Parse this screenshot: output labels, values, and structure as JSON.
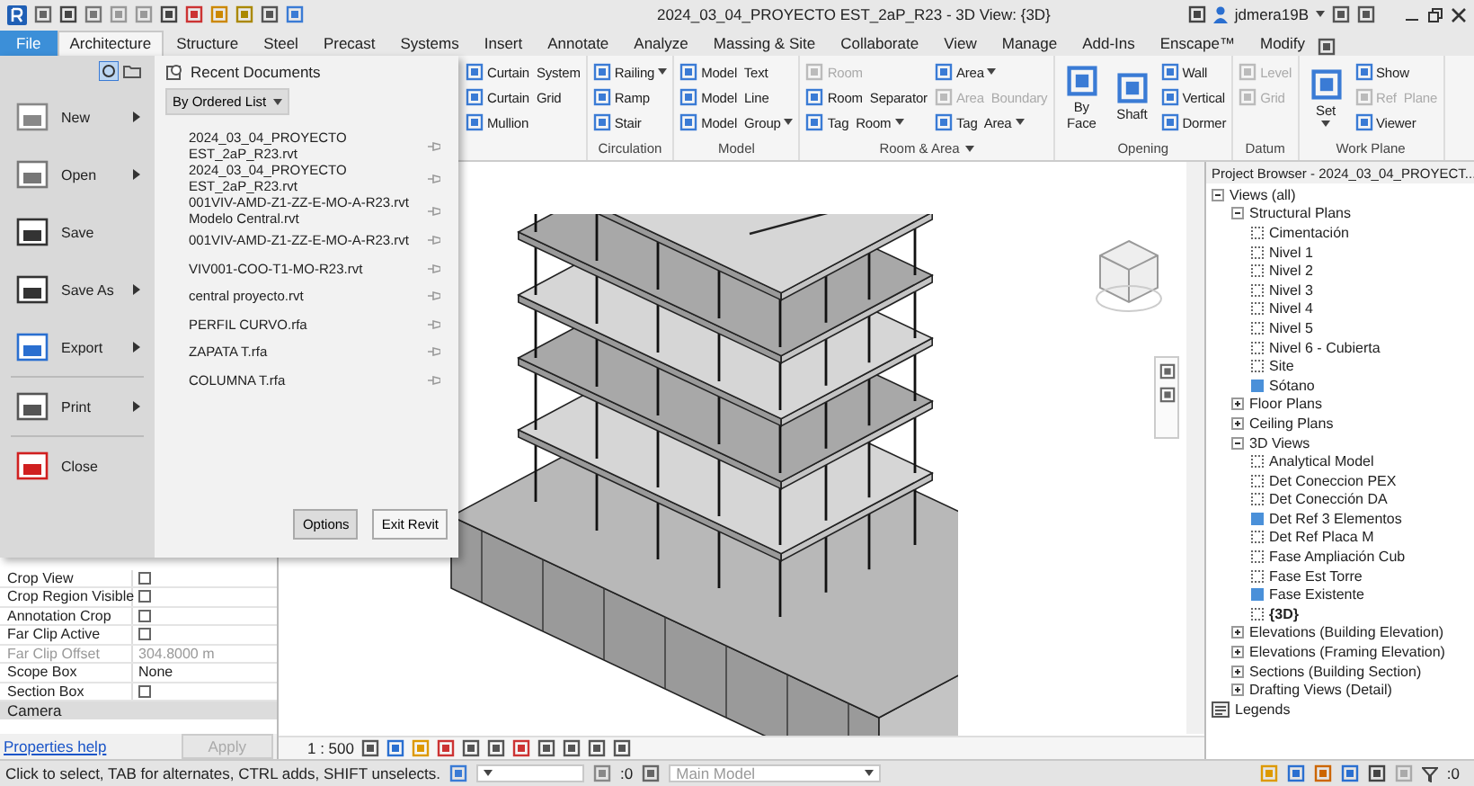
{
  "window": {
    "title": "2024_03_04_PROYECTO EST_2aP_R23 - 3D View: {3D}",
    "user": "jdmera19B"
  },
  "tabs": [
    {
      "label": "File",
      "selected": false,
      "kind": "file"
    },
    {
      "label": "Architecture",
      "selected": true,
      "kind": "tab"
    },
    {
      "label": "Structure",
      "selected": false,
      "kind": "tab"
    },
    {
      "label": "Steel",
      "selected": false,
      "kind": "tab"
    },
    {
      "label": "Precast",
      "selected": false,
      "kind": "tab"
    },
    {
      "label": "Systems",
      "selected": false,
      "kind": "tab"
    },
    {
      "label": "Insert",
      "selected": false,
      "kind": "tab"
    },
    {
      "label": "Annotate",
      "selected": false,
      "kind": "tab"
    },
    {
      "label": "Analyze",
      "selected": false,
      "kind": "tab"
    },
    {
      "label": "Massing & Site",
      "selected": false,
      "kind": "tab"
    },
    {
      "label": "Collaborate",
      "selected": false,
      "kind": "tab"
    },
    {
      "label": "View",
      "selected": false,
      "kind": "tab"
    },
    {
      "label": "Manage",
      "selected": false,
      "kind": "tab"
    },
    {
      "label": "Add-Ins",
      "selected": false,
      "kind": "tab"
    },
    {
      "label": "Enscape™",
      "selected": false,
      "kind": "tab"
    },
    {
      "label": "Modify",
      "selected": false,
      "kind": "tab"
    }
  ],
  "ribbon": {
    "panels": [
      {
        "tools": [
          {
            "label": "Curtain  System",
            "kind": "small",
            "disabled": false,
            "dropdown": false
          },
          {
            "label": "Curtain  Grid",
            "kind": "small",
            "disabled": false,
            "dropdown": false
          },
          {
            "label": "Mullion",
            "kind": "small",
            "disabled": false,
            "dropdown": false
          }
        ]
      },
      {
        "title": "Circulation",
        "tools": [
          {
            "label": "Railing",
            "kind": "small",
            "disabled": false,
            "dropdown": true
          },
          {
            "label": "Ramp",
            "kind": "small",
            "disabled": false,
            "dropdown": false
          },
          {
            "label": "Stair",
            "kind": "small",
            "disabled": false,
            "dropdown": false
          }
        ]
      },
      {
        "title": "Model",
        "tools": [
          {
            "label": "Model  Text",
            "kind": "small",
            "disabled": false,
            "dropdown": false
          },
          {
            "label": "Model  Line",
            "kind": "small",
            "disabled": false,
            "dropdown": false
          },
          {
            "label": "Model  Group",
            "kind": "small",
            "disabled": false,
            "dropdown": true
          }
        ]
      },
      {
        "title": "Room & Area",
        "title_dropdown": true,
        "tools": [
          {
            "label": "Room",
            "kind": "small",
            "disabled": true,
            "dropdown": false
          },
          {
            "label": "Room  Separator",
            "kind": "small",
            "disabled": false,
            "dropdown": false
          },
          {
            "label": "Tag  Room",
            "kind": "small",
            "disabled": false,
            "dropdown": true
          },
          {
            "label": "Area",
            "kind": "small",
            "disabled": false,
            "dropdown": true
          },
          {
            "label": "Area  Boundary",
            "kind": "small",
            "disabled": true,
            "dropdown": false
          },
          {
            "label": "Tag  Area",
            "kind": "small",
            "disabled": false,
            "dropdown": true
          }
        ]
      },
      {
        "title": "Opening",
        "tools": [
          {
            "label": "By Face",
            "kind": "large",
            "disabled": false,
            "dropdown": false
          },
          {
            "label": "Shaft",
            "kind": "large",
            "disabled": false,
            "dropdown": false
          },
          {
            "label": "Wall",
            "kind": "small",
            "disabled": false,
            "dropdown": false
          },
          {
            "label": "Vertical",
            "kind": "small",
            "disabled": false,
            "dropdown": false
          },
          {
            "label": "Dormer",
            "kind": "small",
            "disabled": false,
            "dropdown": false
          }
        ]
      },
      {
        "title": "Datum",
        "tools": [
          {
            "label": "Level",
            "kind": "small",
            "disabled": true,
            "dropdown": false
          },
          {
            "label": "Grid",
            "kind": "small",
            "disabled": true,
            "dropdown": false
          }
        ]
      },
      {
        "title": "Work Plane",
        "tools": [
          {
            "label": "Set",
            "kind": "large",
            "disabled": false,
            "dropdown": true
          },
          {
            "label": "Show",
            "kind": "small",
            "disabled": false,
            "dropdown": false
          },
          {
            "label": "Ref  Plane",
            "kind": "small",
            "disabled": true,
            "dropdown": false
          },
          {
            "label": "Viewer",
            "kind": "small",
            "disabled": false,
            "dropdown": false
          }
        ]
      }
    ]
  },
  "file_menu": {
    "commands": [
      {
        "label": "New",
        "submenu": true
      },
      {
        "label": "Open",
        "submenu": true
      },
      {
        "label": "Save",
        "submenu": false
      },
      {
        "label": "Save As",
        "submenu": true
      },
      {
        "label": "Export",
        "submenu": true
      },
      {
        "label": "Print",
        "submenu": true
      },
      {
        "label": "Close",
        "submenu": false
      }
    ],
    "recent_title": "Recent Documents",
    "sort": "By Ordered List",
    "documents": [
      "2024_03_04_PROYECTO\nEST_2aP_R23.rvt",
      "2024_03_04_PROYECTO\nEST_2aP_R23.rvt",
      "001VIV-AMD-Z1-ZZ-E-MO-A-R23.rvt\nModelo Central.rvt",
      "001VIV-AMD-Z1-ZZ-E-MO-A-R23.rvt",
      "VIV001-COO-T1-MO-R23.rvt",
      "central proyecto.rvt",
      "PERFIL CURVO.rfa",
      "ZAPATA T.rfa",
      "COLUMNA T.rfa"
    ],
    "buttons": [
      "Options",
      "Exit Revit"
    ]
  },
  "properties": {
    "rows": [
      {
        "label": "Crop View",
        "kind": "checkbox",
        "checked": false,
        "disabled": false
      },
      {
        "label": "Crop Region Visible",
        "kind": "checkbox",
        "checked": false,
        "disabled": false
      },
      {
        "label": "Annotation Crop",
        "kind": "checkbox",
        "checked": false,
        "disabled": false
      },
      {
        "label": "Far Clip Active",
        "kind": "checkbox",
        "checked": false,
        "disabled": false
      },
      {
        "label": "Far Clip Offset",
        "kind": "text",
        "value": "304.8000 m",
        "disabled": true
      },
      {
        "label": "Scope Box",
        "kind": "text",
        "value": "None",
        "disabled": false
      },
      {
        "label": "Section Box",
        "kind": "checkbox",
        "checked": false,
        "disabled": false
      }
    ],
    "section": "Camera",
    "help": "Properties help",
    "apply": {
      "label": "Apply",
      "disabled": true
    }
  },
  "view": {
    "scale": "1 : 500"
  },
  "browser": {
    "title": "Project Browser - 2024_03_04_PROYECT...",
    "tree": [
      {
        "label": "Views (all)",
        "expanded": true,
        "children": [
          {
            "label": "Structural Plans",
            "expanded": true,
            "children": [
              {
                "label": "Cimentación",
                "open": false,
                "active": false
              },
              {
                "label": "Nivel 1",
                "open": false,
                "active": false
              },
              {
                "label": "Nivel 2",
                "open": false,
                "active": false
              },
              {
                "label": "Nivel 3",
                "open": false,
                "active": false
              },
              {
                "label": "Nivel 4",
                "open": false,
                "active": false
              },
              {
                "label": "Nivel 5",
                "open": false,
                "active": false
              },
              {
                "label": "Nivel 6 - Cubierta",
                "open": false,
                "active": false
              },
              {
                "label": "Site",
                "open": false,
                "active": false
              },
              {
                "label": "Sótano",
                "open": true,
                "active": false
              }
            ]
          },
          {
            "label": "Floor Plans",
            "expanded": false
          },
          {
            "label": "Ceiling Plans",
            "expanded": false
          },
          {
            "label": "3D Views",
            "expanded": true,
            "children": [
              {
                "label": "Analytical Model",
                "open": false,
                "active": false
              },
              {
                "label": "Det Coneccion PEX",
                "open": false,
                "active": false
              },
              {
                "label": "Det Conección DA",
                "open": false,
                "active": false
              },
              {
                "label": "Det Ref 3 Elementos",
                "open": true,
                "active": false
              },
              {
                "label": "Det Ref Placa M",
                "open": false,
                "active": false
              },
              {
                "label": "Fase Ampliación Cub",
                "open": false,
                "active": false
              },
              {
                "label": "Fase Est Torre",
                "open": false,
                "active": false
              },
              {
                "label": "Fase Existente",
                "open": true,
                "active": false
              },
              {
                "label": "{3D}",
                "open": false,
                "active": true
              }
            ]
          },
          {
            "label": "Elevations (Building Elevation)",
            "expanded": false
          },
          {
            "label": "Elevations (Framing Elevation)",
            "expanded": false
          },
          {
            "label": "Sections (Building Section)",
            "expanded": false
          },
          {
            "label": "Drafting Views (Detail)",
            "expanded": false
          }
        ]
      },
      {
        "label": "Legends",
        "kind": "legends"
      }
    ]
  },
  "status": {
    "message": "Click to select, TAB for alternates, CTRL adds, SHIFT unselects.",
    "workset_count": ":0",
    "model": "Main Model",
    "filter_count": ":0"
  }
}
